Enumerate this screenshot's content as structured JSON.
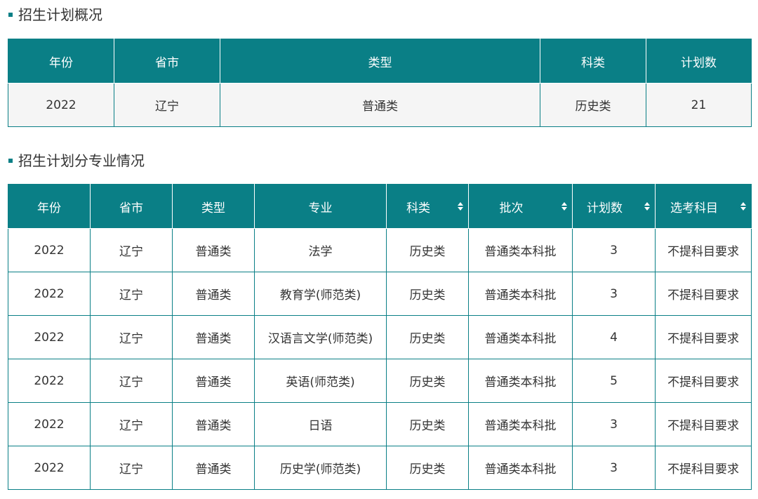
{
  "overview": {
    "title": "招生计划概况",
    "headers": [
      "年份",
      "省市",
      "类型",
      "科类",
      "计划数"
    ],
    "row": [
      "2022",
      "辽宁",
      "普通类",
      "历史类",
      "21"
    ]
  },
  "majors": {
    "title": "招生计划分专业情况",
    "headers": [
      "年份",
      "省市",
      "类型",
      "专业",
      "科类",
      "批次",
      "计划数",
      "选考科目"
    ],
    "sortable": [
      false,
      false,
      false,
      false,
      true,
      true,
      true,
      true
    ],
    "rows": [
      [
        "2022",
        "辽宁",
        "普通类",
        "法学",
        "历史类",
        "普通类本科批",
        "3",
        "不提科目要求"
      ],
      [
        "2022",
        "辽宁",
        "普通类",
        "教育学(师范类)",
        "历史类",
        "普通类本科批",
        "3",
        "不提科目要求"
      ],
      [
        "2022",
        "辽宁",
        "普通类",
        "汉语言文学(师范类)",
        "历史类",
        "普通类本科批",
        "4",
        "不提科目要求"
      ],
      [
        "2022",
        "辽宁",
        "普通类",
        "英语(师范类)",
        "历史类",
        "普通类本科批",
        "5",
        "不提科目要求"
      ],
      [
        "2022",
        "辽宁",
        "普通类",
        "日语",
        "历史类",
        "普通类本科批",
        "3",
        "不提科目要求"
      ],
      [
        "2022",
        "辽宁",
        "普通类",
        "历史学(师范类)",
        "历史类",
        "普通类本科批",
        "3",
        "不提科目要求"
      ]
    ]
  },
  "colors": {
    "accent": "#0a7f86",
    "row_bg": "#f5f5f5"
  }
}
